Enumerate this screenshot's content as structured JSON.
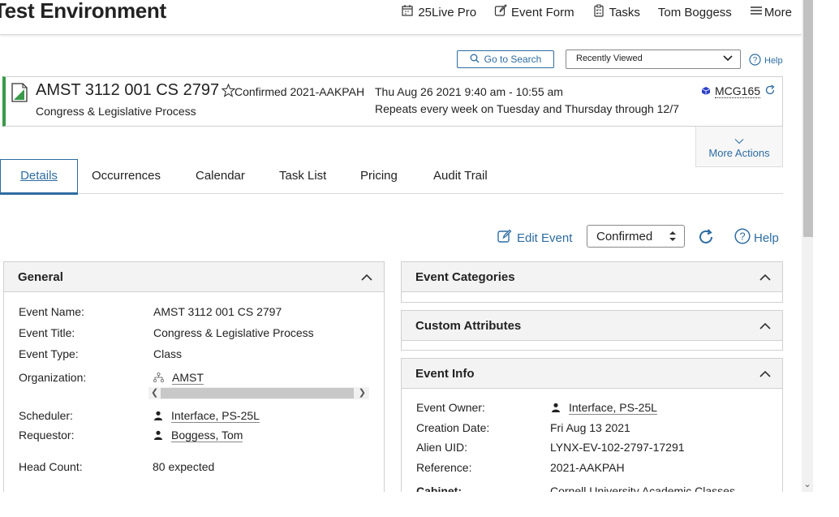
{
  "header": {
    "brand": "Test Environment",
    "nav": [
      {
        "label": "25Live Pro",
        "icon": "calendar-icon"
      },
      {
        "label": "Event Form",
        "icon": "edit-icon"
      },
      {
        "label": "Tasks",
        "icon": "clipboard-icon"
      },
      {
        "label": "Tom Boggess",
        "icon": ""
      },
      {
        "label": "More",
        "icon": "menu-icon"
      }
    ]
  },
  "search": {
    "goto_label": "Go to Search",
    "recently_viewed": "Recently Viewed",
    "help_label": "Help"
  },
  "event": {
    "name": "AMST 3112 001 CS 2797",
    "state": "Confirmed",
    "reference": "2021-AAKPAH",
    "when": "Thu Aug 26 2021 9:40 am - 10:55 am",
    "title": "Congress & Legislative Process",
    "repeat": "Repeats every week on Tuesday and Thursday through 12/7",
    "location": "MCG165",
    "more_actions": "More Actions"
  },
  "tabs": [
    "Details",
    "Occurrences",
    "Calendar",
    "Task List",
    "Pricing",
    "Audit Trail"
  ],
  "active_tab": "Details",
  "toolbar": {
    "edit_event": "Edit Event",
    "state_value": "Confirmed",
    "help_label": "Help"
  },
  "general": {
    "heading": "General",
    "fields": {
      "event_name_label": "Event Name:",
      "event_name": "AMST 3112 001 CS 2797",
      "event_title_label": "Event Title:",
      "event_title": "Congress & Legislative Process",
      "event_type_label": "Event Type:",
      "event_type": "Class",
      "organization_label": "Organization:",
      "organization": "AMST",
      "scheduler_label": "Scheduler:",
      "scheduler": "Interface, PS-25L",
      "requestor_label": "Requestor:",
      "requestor": "Boggess, Tom",
      "head_count_label": "Head Count:",
      "head_count": "80 expected"
    }
  },
  "event_categories": {
    "heading": "Event Categories"
  },
  "custom_attributes": {
    "heading": "Custom Attributes"
  },
  "event_info": {
    "heading": "Event Info",
    "fields": {
      "owner_label": "Event Owner:",
      "owner": "Interface, PS-25L",
      "creation_label": "Creation Date:",
      "creation": "Fri Aug 13 2021",
      "alien_label": "Alien UID:",
      "alien": "LYNX-EV-102-2797-17291",
      "reference_label": "Reference:",
      "reference": "2021-AAKPAH",
      "cabinet_label": "Cabinet:",
      "cabinet": "Cornell University Academic Classes"
    }
  },
  "colors": {
    "accent": "#2d6ca2",
    "confirmed_bar": "#3a9a4a",
    "location_icon": "#2b3fc9"
  }
}
